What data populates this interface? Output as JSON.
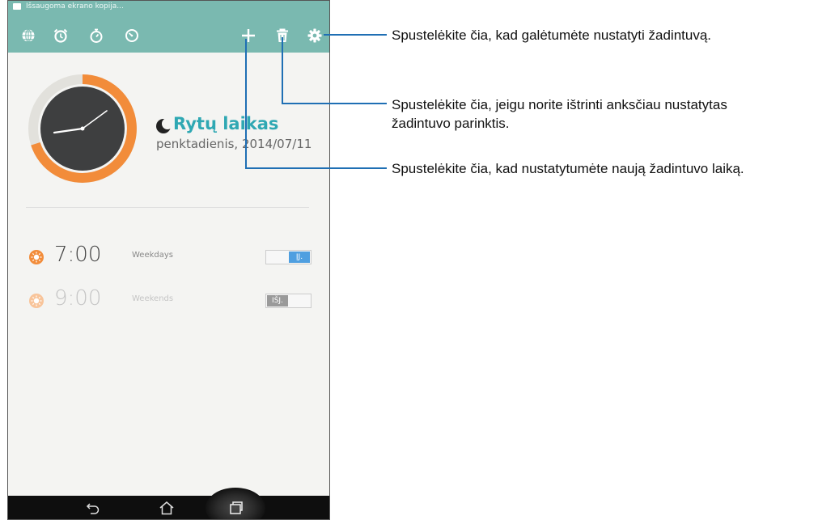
{
  "status_bar": {
    "notification": "Išsaugoma ekrano kopija..."
  },
  "action_bar": {
    "icons": [
      "globe-icon",
      "alarm-clock-icon",
      "stopwatch-icon",
      "timer-icon",
      "add-icon",
      "trash-icon",
      "gear-icon"
    ]
  },
  "clock": {
    "timezone_name": "Rytų laikas",
    "date": "penktadienis, 2014/07/11"
  },
  "alarms": [
    {
      "time": "7:00",
      "days": "Weekdays",
      "toggle_label": "ĮJ.",
      "enabled": true
    },
    {
      "time": "9:00",
      "days": "Weekends",
      "toggle_label": "IŠJ.",
      "enabled": false
    }
  ],
  "callouts": {
    "settings": "Spustelėkite čia, kad galėtumėte nustatyti žadintuvą.",
    "delete_line1": "Spustelėkite čia, jeigu norite ištrinti anksčiau nustatytas",
    "delete_line2": "žadintuvo parinktis.",
    "add": "Spustelėkite čia, kad nustatytumėte naują žadintuvo laiką."
  },
  "colors": {
    "action_bar": "#7ab9b0",
    "accent_orange": "#f28c3a",
    "timezone_text": "#2fa8b3",
    "toggle_on": "#4f9fe0",
    "toggle_off": "#9a9a9a",
    "callout_line": "#1f6fb4"
  }
}
